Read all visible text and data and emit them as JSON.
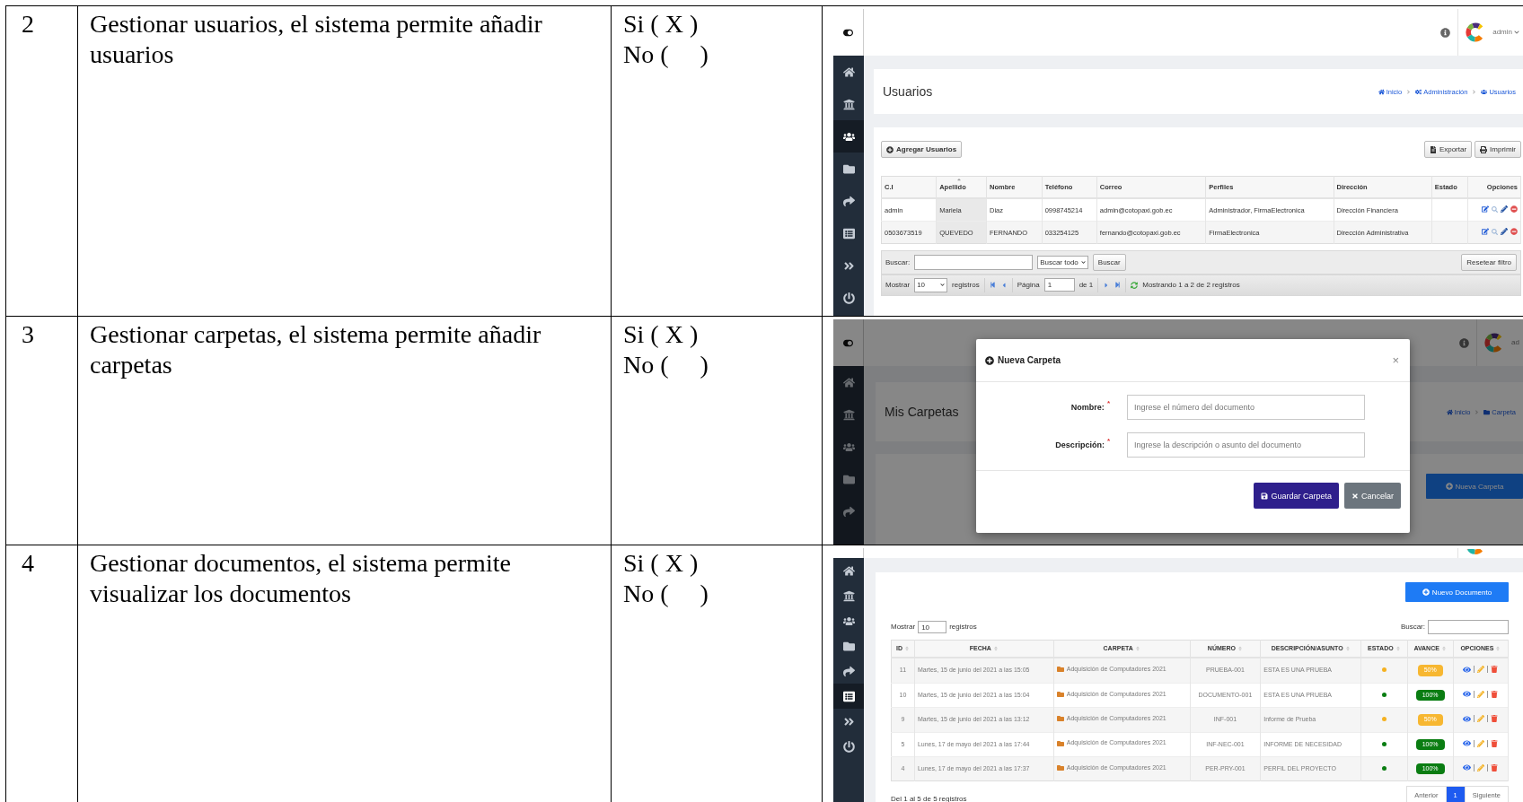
{
  "document_rows": [
    {
      "number": "2",
      "requirement": "Gestionar usuarios, el sistema permite añadir usuarios",
      "answers": [
        "Si ( X )",
        "No (     )"
      ],
      "screenshot": {
        "kind": "users",
        "sidebar": [
          {
            "selected": false
          },
          {
            "selected": false
          },
          {
            "selected": true
          },
          {
            "selected": false
          },
          {
            "selected": false
          },
          {
            "selected": false
          },
          {
            "selected": false
          },
          {
            "selected": false
          }
        ],
        "user_menu": "admin",
        "page_title": "Usuarios",
        "breadcrumb": [
          "Inicio",
          "Administración",
          "Usuarios"
        ],
        "add_button": "Agregar Usuarios",
        "toolbar_buttons": [
          "Exportar",
          "Imprimir"
        ],
        "columns": [
          {
            "label": "C.I",
            "sorted": false
          },
          {
            "label": "Apellido",
            "sorted": true
          },
          {
            "label": "Nombre",
            "sorted": false
          },
          {
            "label": "Teléfono",
            "sorted": false
          },
          {
            "label": "Correo",
            "sorted": false
          },
          {
            "label": "Perfiles",
            "sorted": false
          },
          {
            "label": "Dirección",
            "sorted": false
          },
          {
            "label": "Estado",
            "sorted": false
          },
          {
            "label": "Opciones",
            "sorted": false
          }
        ],
        "rows": [
          {
            "ci": "admin",
            "last_name": "Mariela",
            "first_name": "Diaz",
            "phone": "0998745214",
            "email": "admin@cotopaxi.gob.ec",
            "profiles": "Administrador, FirmaElectronica",
            "department": "Dirección Financiera"
          },
          {
            "ci": "0503673519",
            "last_name": "QUEVEDO",
            "first_name": "FERNANDO",
            "phone": "033254125",
            "email": "fernando@cotopaxi.gob.ec",
            "profiles": "FirmaElectronica",
            "department": "Dirección Administrativa"
          }
        ],
        "filter": {
          "label": "Buscar:",
          "scope": "Buscar todo",
          "button": "Buscar",
          "reset": "Resetear filtro"
        },
        "pager": {
          "show_label": "Mostrar",
          "page_size": "10",
          "records_label": "registros",
          "page_label": "Página",
          "page": "1",
          "of": "de 1",
          "summary": "Mostrando 1 a 2 de 2 registros"
        }
      }
    },
    {
      "number": "3",
      "requirement": "Gestionar carpetas, el sistema permite añadir carpetas",
      "answers": [
        "Si ( X )",
        "No (     )"
      ],
      "screenshot": {
        "kind": "folder_modal",
        "sidebar": [
          {
            "selected": false
          },
          {
            "selected": false
          },
          {
            "selected": false
          },
          {
            "selected": false
          },
          {
            "selected": false
          }
        ],
        "user_menu": "ad",
        "page_title": "Mis Carpetas",
        "breadcrumb": [
          "Inicio",
          "Carpeta"
        ],
        "new_button": "Nueva Carpeta",
        "modal": {
          "title": "Nueva Carpeta",
          "close": "×",
          "fields": [
            {
              "label": "Nombre:",
              "required_mark": "*",
              "placeholder": "Ingrese el número del documento"
            },
            {
              "label": "Descripción:",
              "required_mark": "*",
              "placeholder": "Ingrese la descripción o asunto del documento"
            }
          ],
          "buttons": [
            {
              "kind": "primary",
              "label": "Guardar Carpeta"
            },
            {
              "kind": "secondary",
              "label": "Cancelar"
            }
          ]
        }
      }
    },
    {
      "number": "4",
      "requirement": "Gestionar documentos, el sistema permite visualizar los documentos",
      "answers": [
        "Si ( X )",
        "No (     )"
      ],
      "screenshot": {
        "kind": "documents",
        "sidebar": [
          {
            "selected": false
          },
          {
            "selected": false
          },
          {
            "selected": false
          },
          {
            "selected": false
          },
          {
            "selected": false
          },
          {
            "selected": true
          },
          {
            "selected": false
          },
          {
            "selected": false
          }
        ],
        "new_button": "Nuevo Documento",
        "show_label": "Mostrar",
        "page_size": "10",
        "records_label": "registros",
        "search_label": "Buscar:",
        "columns": [
          "ID",
          "FECHA",
          "CARPETA",
          "NÚMERO",
          "DESCRIPCIÓN/ASUNTO",
          "ESTADO",
          "AVANCE",
          "OPCIONES"
        ],
        "rows": [
          {
            "id": "11",
            "date": "Martes, 15 de junio del 2021 a las 15:05",
            "folder": "Adquisición de Computadores 2021",
            "number": "PRUEBA-001",
            "description": "ESTA ES UNA PRUEBA",
            "status": {
              "color": "#f5b120"
            },
            "progress": {
              "label": "50%",
              "color": "#f7b731"
            }
          },
          {
            "id": "10",
            "date": "Martes, 15 de junio del 2021 a las 15:04",
            "folder": "Adquisición de Computadores 2021",
            "number": "DOCUMENTO-001",
            "description": "ESTA ES UNA PRUEBA",
            "status": {
              "color": "#0a7d12"
            },
            "progress": {
              "label": "100%",
              "color": "#0a7d12"
            }
          },
          {
            "id": "9",
            "date": "Martes, 15 de junio del 2021 a las 13:12",
            "folder": "Adquisición de Computadores 2021",
            "number": "INF-001",
            "description": "Informe de Prueba",
            "status": {
              "color": "#f5b120"
            },
            "progress": {
              "label": "50%",
              "color": "#f7b731"
            }
          },
          {
            "id": "5",
            "date": "Lunes, 17 de mayo del 2021 a las 17:44",
            "folder": "Adquisición de Computadores 2021",
            "number": "INF-NEC-001",
            "description": "INFORME DE NECESIDAD",
            "status": {
              "color": "#0a7d12"
            },
            "progress": {
              "label": "100%",
              "color": "#0a7d12"
            }
          },
          {
            "id": "4",
            "date": "Lunes, 17 de mayo del 2021 a las 17:37",
            "folder": "Adquisición de Computadores 2021",
            "number": "PER-PRY-001",
            "description": "PERFIL DEL PROYECTO",
            "status": {
              "color": "#0a7d12"
            },
            "progress": {
              "label": "100%",
              "color": "#0a7d12"
            }
          }
        ],
        "summary": "Del 1 al 5 de 5 registros",
        "pagination": [
          {
            "label": "Anterior",
            "selected": false
          },
          {
            "label": "1",
            "selected": true
          },
          {
            "label": "Siguiente",
            "selected": false
          }
        ]
      }
    }
  ]
}
